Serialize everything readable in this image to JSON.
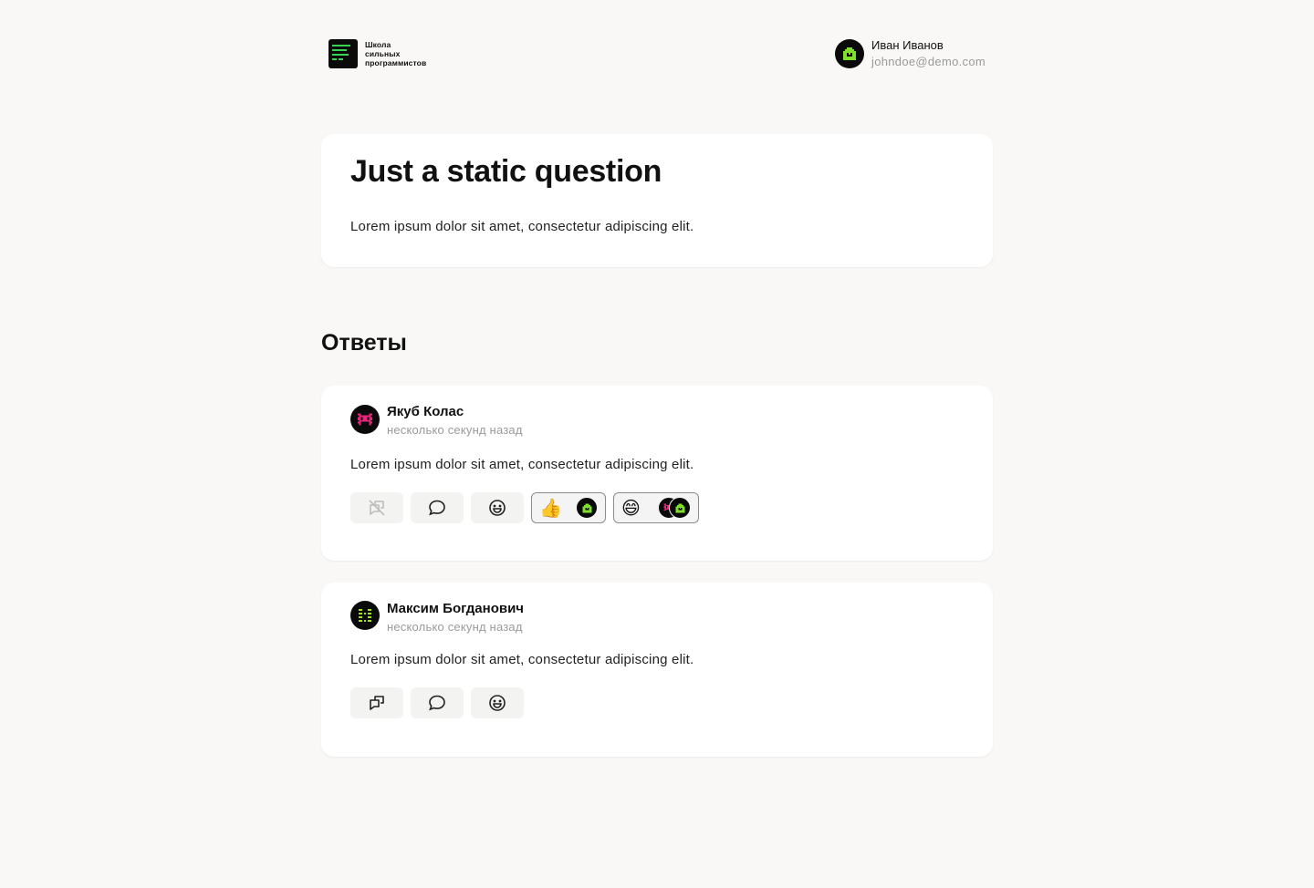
{
  "header": {
    "logo_lines": [
      "Школа",
      "сильных",
      "программистов"
    ],
    "user": {
      "name": "Иван Иванов",
      "email": "johndoe@demo.com"
    }
  },
  "question": {
    "title": "Just a static question",
    "body": "Lorem ipsum dolor sit amet, consectetur adipiscing elit."
  },
  "answers_title": "Ответы",
  "answers": [
    {
      "author": "Якуб Колас",
      "time": "несколько секунд назад",
      "body": "Lorem ipsum dolor sit amet, consectetur adipiscing elit.",
      "avatar_icon": "pink-invader-icon",
      "actions": [
        "mark-answer-disabled-icon",
        "comment-icon",
        "add-reaction-icon"
      ],
      "reactions": [
        {
          "emoji": "👍",
          "users": [
            "green-house-icon"
          ]
        },
        {
          "emoji": "😄",
          "users": [
            "pink-invader-icon",
            "green-house-icon"
          ]
        }
      ]
    },
    {
      "author": "Максим Богданович",
      "time": "несколько секунд назад",
      "body": "Lorem ipsum dolor sit amet, consectetur adipiscing elit.",
      "avatar_icon": "green-dots-icon",
      "actions": [
        "mark-answer-icon",
        "comment-icon",
        "add-reaction-icon"
      ],
      "reactions": []
    }
  ],
  "colors": {
    "background": "#f9f8f6",
    "card": "#ffffff",
    "accent_green": "#39d353",
    "accent_pink": "#e8257a",
    "muted": "#9a9a9a"
  }
}
